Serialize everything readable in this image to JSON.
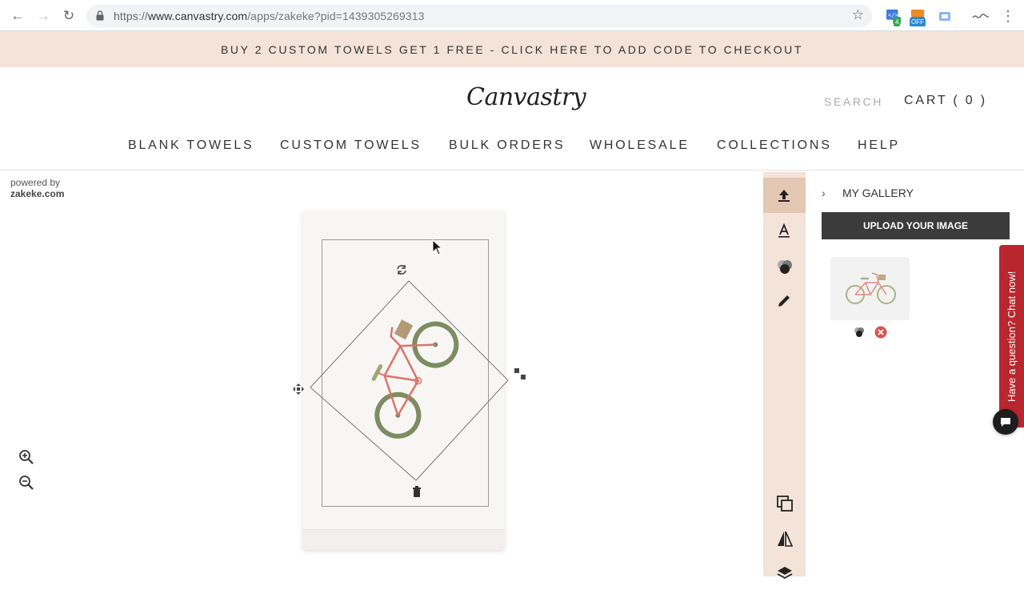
{
  "browser": {
    "url_scheme": "https://",
    "url_host": "www.canvastry.com",
    "url_path": "/apps/zakeke?pid=1439305269313",
    "extension_badge_count": "4",
    "extension_badge_off": "OFF"
  },
  "promo": {
    "text": "BUY 2 CUSTOM TOWELS GET 1 FREE - CLICK HERE TO ADD CODE TO CHECKOUT"
  },
  "header": {
    "logo": "Canvastry",
    "search_label": "SEARCH",
    "cart_label": "CART ( 0 )"
  },
  "nav": {
    "items": [
      {
        "label": "BLANK TOWELS"
      },
      {
        "label": "CUSTOM TOWELS"
      },
      {
        "label": "BULK ORDERS"
      },
      {
        "label": "WHOLESALE"
      },
      {
        "label": "COLLECTIONS"
      },
      {
        "label": "HELP"
      }
    ]
  },
  "customizer": {
    "powered_by": "powered by",
    "powered_brand": "zakeke.com"
  },
  "gallery": {
    "title": "MY GALLERY",
    "upload_label": "UPLOAD YOUR IMAGE"
  },
  "chat": {
    "label": "Have a question? Chat now!"
  },
  "colors": {
    "promo_bg": "#f3e3d8",
    "tool_strip_bg": "#f3e3d8",
    "tool_active_bg": "#e4c7b4",
    "upload_btn_bg": "#3b3b3b",
    "chat_tab_bg": "#b9262e"
  }
}
